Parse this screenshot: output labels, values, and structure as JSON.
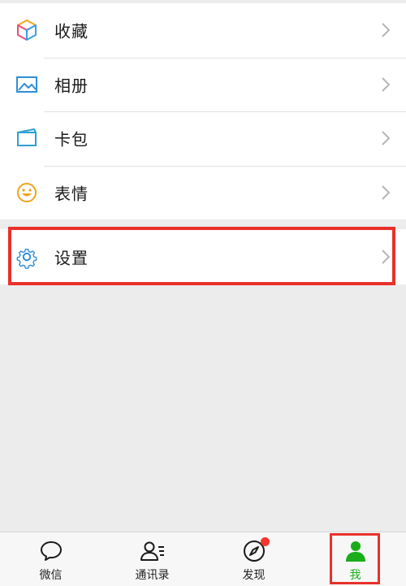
{
  "menu": {
    "items": [
      {
        "label": "收藏",
        "icon": "favorites-cube-icon"
      },
      {
        "label": "相册",
        "icon": "album-photo-icon"
      },
      {
        "label": "卡包",
        "icon": "card-wallet-icon"
      },
      {
        "label": "表情",
        "icon": "sticker-smile-icon"
      }
    ],
    "settings": {
      "label": "设置",
      "icon": "gear-icon"
    }
  },
  "tabbar": {
    "tabs": [
      {
        "label": "微信",
        "icon": "chat-bubble-icon"
      },
      {
        "label": "通讯录",
        "icon": "contacts-icon"
      },
      {
        "label": "发现",
        "icon": "compass-icon",
        "badge": "red-dot"
      },
      {
        "label": "我",
        "icon": "me-person-icon",
        "active": true
      }
    ]
  },
  "colors": {
    "highlight": "#e8312a",
    "active_tab": "#1aad19",
    "badge": "#f43530",
    "background": "#ececec"
  }
}
